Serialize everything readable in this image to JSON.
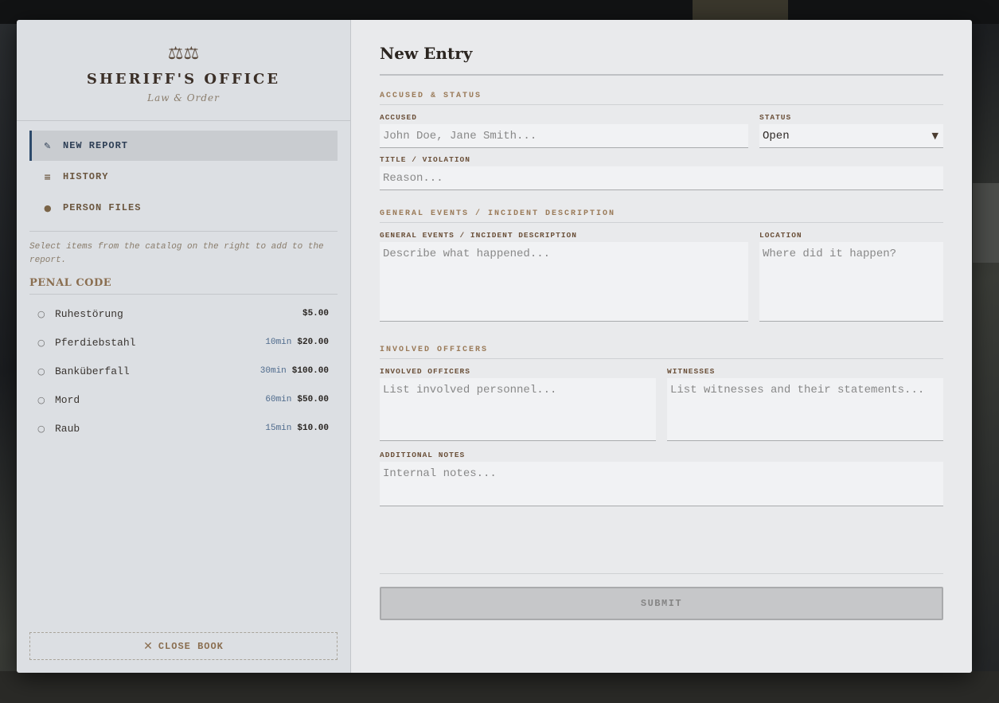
{
  "brand": {
    "icon": "scales-icon",
    "icon_glyph": "⚖⚖",
    "title": "SHERIFF'S OFFICE",
    "subtitle": "Law & Order"
  },
  "nav": {
    "items": [
      {
        "icon": "pen-icon",
        "glyph": "✎",
        "label": "NEW REPORT",
        "active": true
      },
      {
        "icon": "list-icon",
        "glyph": "≡",
        "label": "HISTORY",
        "active": false
      },
      {
        "icon": "person-icon",
        "glyph": "●",
        "label": "PERSON FILES",
        "active": false
      }
    ]
  },
  "sidebar": {
    "hint": "Select items from the catalog on the right to add to the report.",
    "penal_heading": "PENAL CODE",
    "penal_items": [
      {
        "name": "Ruhestörung",
        "time": "",
        "price": "$5.00"
      },
      {
        "name": "Pferdiebstahl",
        "time": "10min",
        "price": "$20.00"
      },
      {
        "name": "Banküberfall",
        "time": "30min",
        "price": "$100.00"
      },
      {
        "name": "Mord",
        "time": "60min",
        "price": "$50.00"
      },
      {
        "name": "Raub",
        "time": "15min",
        "price": "$10.00"
      }
    ],
    "close_label": "CLOSE BOOK"
  },
  "form": {
    "title": "New Entry",
    "section_accused": "ACCUSED & STATUS",
    "accused_label": "ACCUSED",
    "accused_placeholder": "John Doe, Jane Smith...",
    "status_label": "STATUS",
    "status_value": "Open",
    "title_label": "TITLE / VIOLATION",
    "title_placeholder": "Reason...",
    "section_events": "GENERAL EVENTS / INCIDENT DESCRIPTION",
    "events_label": "GENERAL EVENTS / INCIDENT DESCRIPTION",
    "events_placeholder": "Describe what happened...",
    "location_label": "LOCATION",
    "location_placeholder": "Where did it happen?",
    "section_officers": "INVOLVED OFFICERS",
    "officers_label": "INVOLVED OFFICERS",
    "officers_placeholder": "List involved personnel...",
    "witnesses_label": "WITNESSES",
    "witnesses_placeholder": "List witnesses and their statements...",
    "notes_label": "ADDITIONAL NOTES",
    "notes_placeholder": "Internal notes...",
    "submit_label": "SUBMIT"
  },
  "colors": {
    "accent_active": "#2d4a6b",
    "section_label": "#9a7a58",
    "time_blue": "#4e6a8c"
  }
}
